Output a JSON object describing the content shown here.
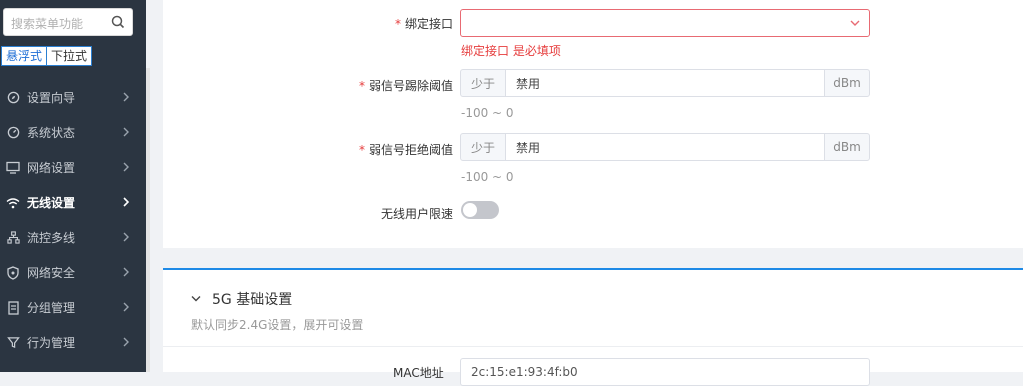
{
  "sidebar": {
    "search_placeholder": "搜索菜单功能",
    "mode_tabs": [
      {
        "label": "悬浮式",
        "active": true
      },
      {
        "label": "下拉式",
        "active": false
      }
    ],
    "items": [
      {
        "label": "设置向导",
        "icon": "compass-icon"
      },
      {
        "label": "系统状态",
        "icon": "gauge-icon"
      },
      {
        "label": "网络设置",
        "icon": "monitor-icon"
      },
      {
        "label": "无线设置",
        "icon": "wifi-icon",
        "active": true
      },
      {
        "label": "流控多线",
        "icon": "network-tree-icon"
      },
      {
        "label": "网络安全",
        "icon": "shield-icon"
      },
      {
        "label": "分组管理",
        "icon": "document-icon"
      },
      {
        "label": "行为管理",
        "icon": "filter-icon"
      }
    ]
  },
  "form": {
    "bind_interface": {
      "label": "绑定接口",
      "value": "",
      "error": "绑定接口 是必填项"
    },
    "weak_signal_kick": {
      "label": "弱信号踢除阈值",
      "prefix": "少于",
      "value": "禁用",
      "suffix": "dBm",
      "hint": "-100 ~ 0"
    },
    "weak_signal_reject": {
      "label": "弱信号拒绝阈值",
      "prefix": "少于",
      "value": "禁用",
      "suffix": "dBm",
      "hint": "-100 ~ 0"
    },
    "wireless_rate_limit": {
      "label": "无线用户限速",
      "enabled": false
    }
  },
  "section_5g": {
    "title": "5G 基础设置",
    "subtitle": "默认同步2.4G设置，展开可设置",
    "mac_label": "MAC地址",
    "mac_value": "2c:15:e1:93:4f:b0"
  },
  "colors": {
    "sidebar_bg": "#2b3541",
    "accent": "#1e8ae6",
    "error": "#e63c3c"
  }
}
